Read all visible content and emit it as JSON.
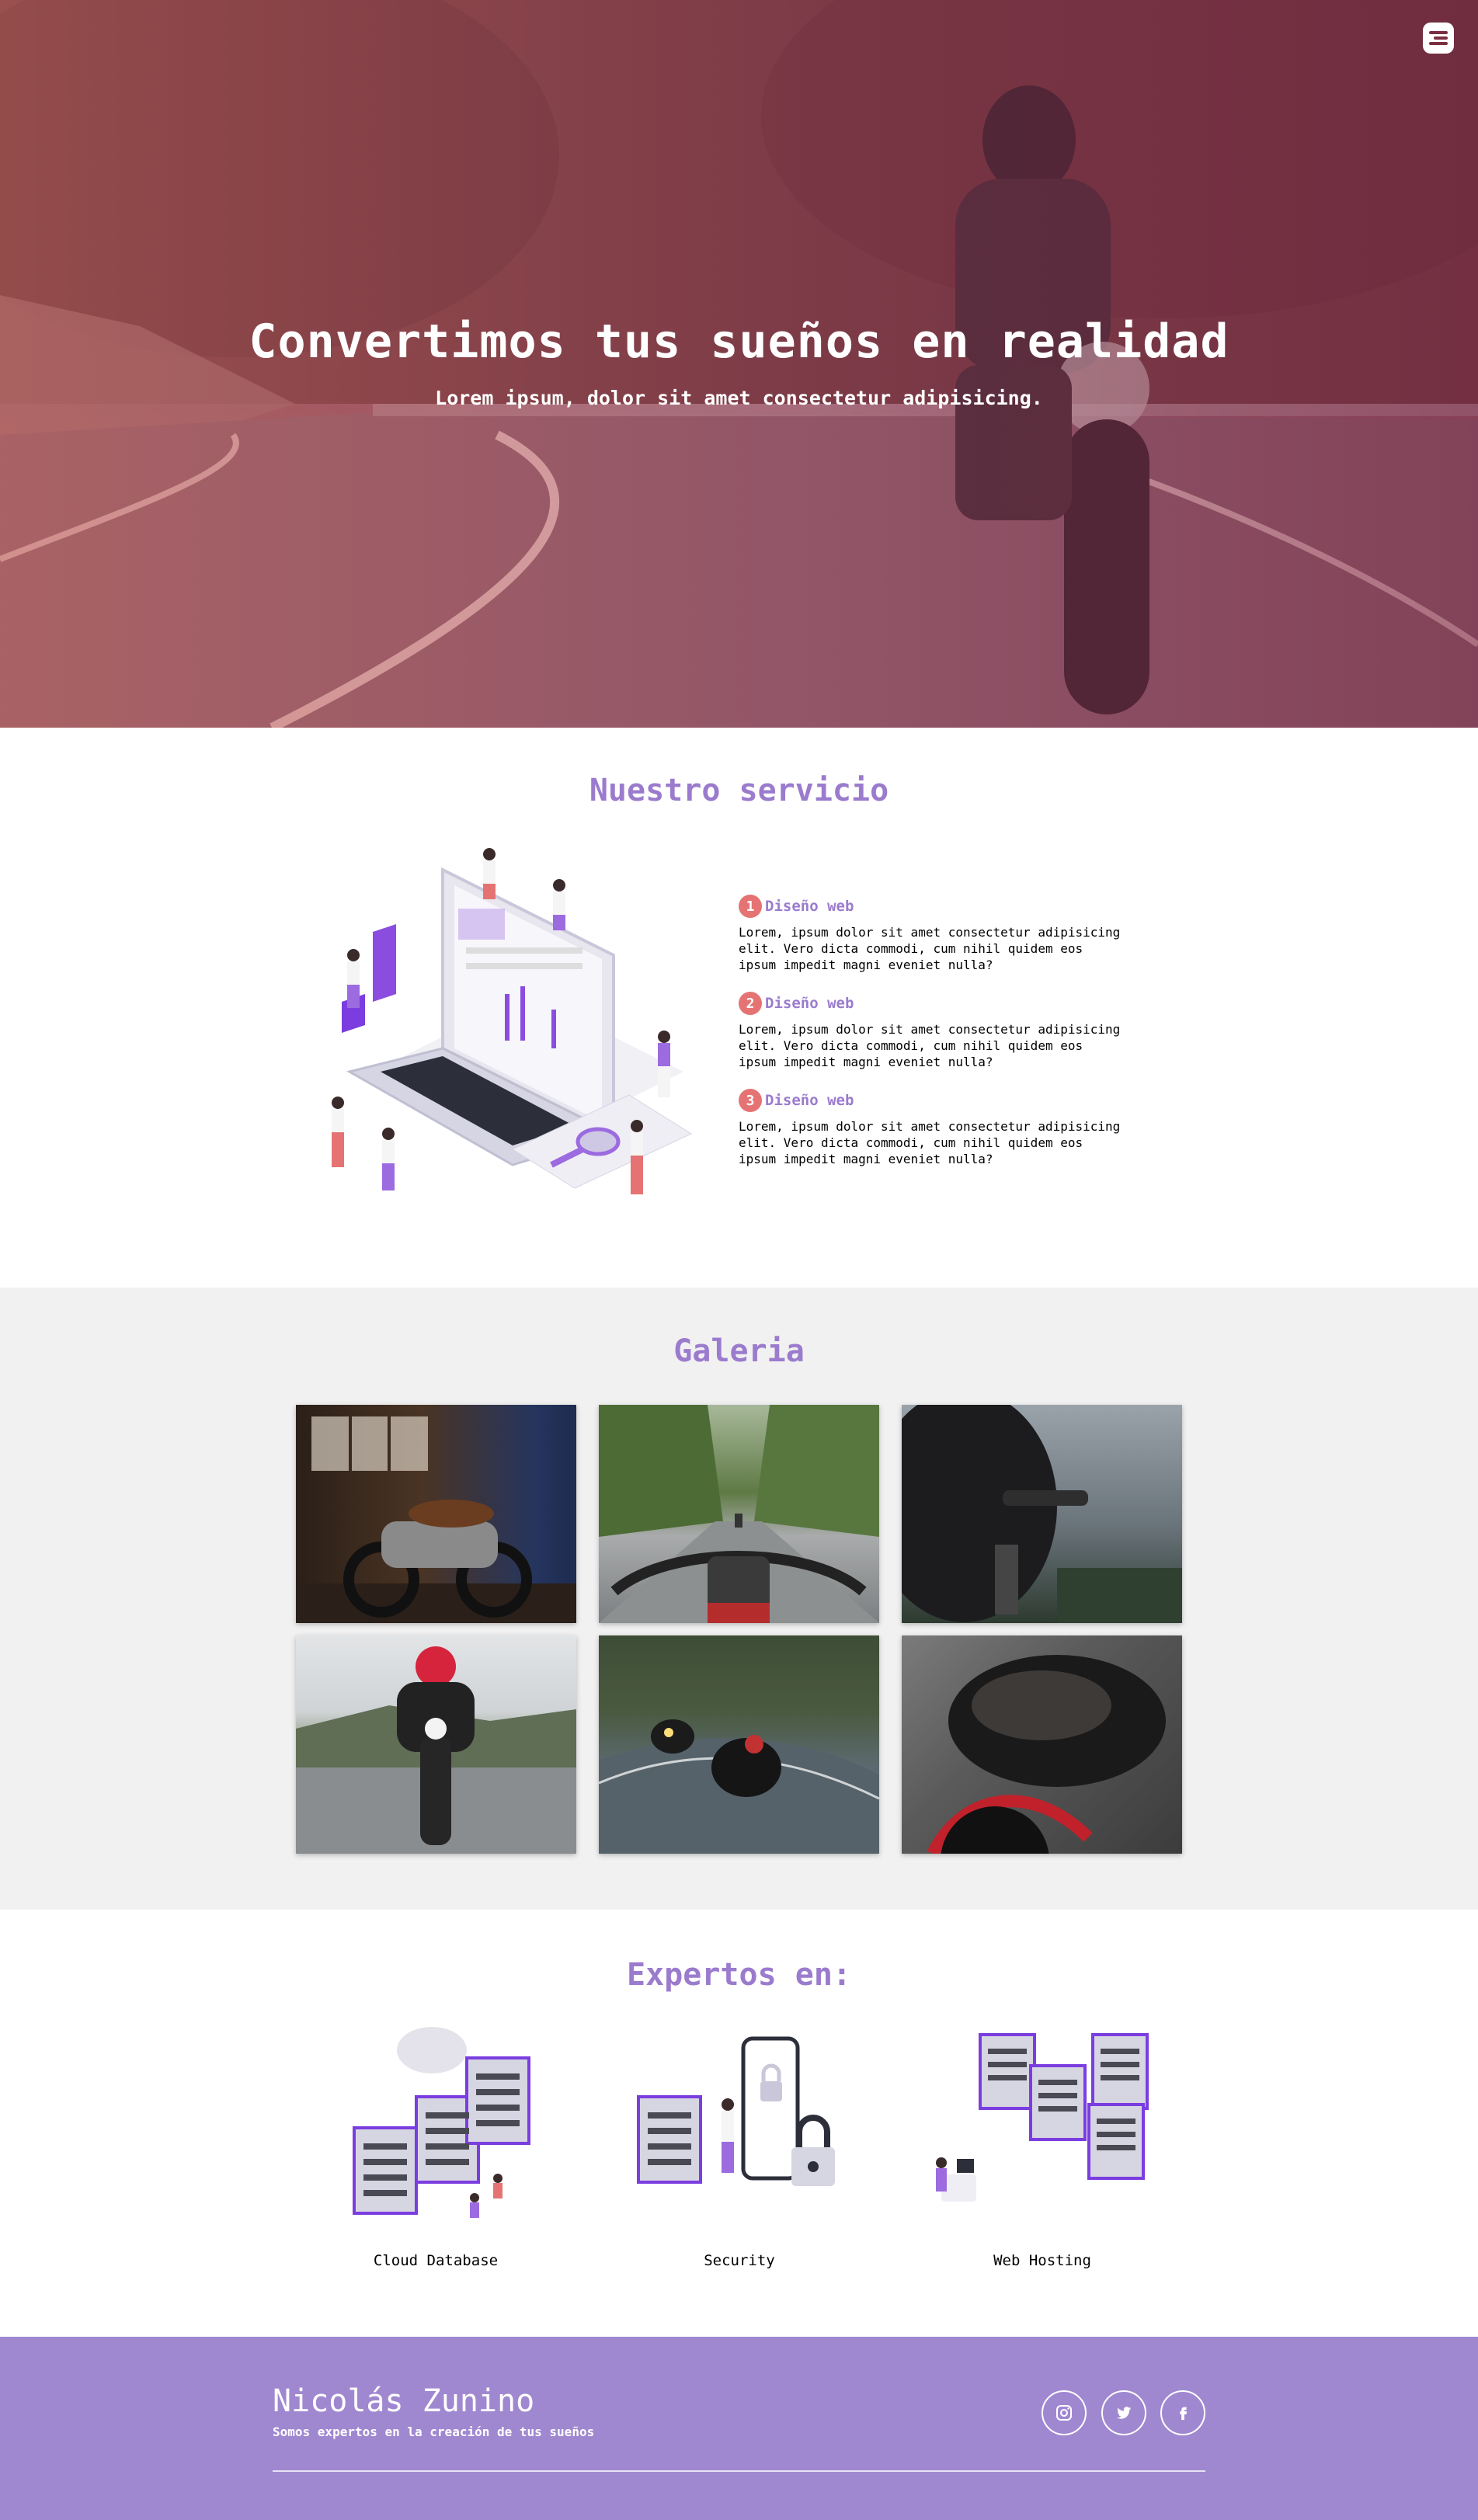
{
  "hero": {
    "title": "Convertimos tus sueños en realidad",
    "subtitle": "Lorem ipsum, dolor sit amet consectetur adipisicing."
  },
  "services": {
    "title": "Nuestro servicio",
    "items": [
      {
        "number": "1",
        "name": "Diseño web",
        "description": "Lorem, ipsum dolor sit amet consectetur adipisicing elit. Vero dicta commodi, cum nihil quidem eos ipsum impedit magni eveniet nulla?"
      },
      {
        "number": "2",
        "name": "Diseño web",
        "description": "Lorem, ipsum dolor sit amet consectetur adipisicing elit. Vero dicta commodi, cum nihil quidem eos ipsum impedit magni eveniet nulla?"
      },
      {
        "number": "3",
        "name": "Diseño web",
        "description": "Lorem, ipsum dolor sit amet consectetur adipisicing elit. Vero dicta commodi, cum nihil quidem eos ipsum impedit magni eveniet nulla?"
      }
    ]
  },
  "gallery": {
    "title": "Galeria"
  },
  "experts": {
    "title": "Expertos en:",
    "items": [
      {
        "label": "Cloud Database"
      },
      {
        "label": "Security"
      },
      {
        "label": "Web Hosting"
      }
    ]
  },
  "footer": {
    "name": "Nicolás Zunino",
    "tagline": "Somos expertos en la creación de tus sueños",
    "social": [
      "instagram-icon",
      "twitter-icon",
      "facebook-icon"
    ]
  },
  "colors": {
    "accent": "#9b7bcd",
    "footer_bg": "#a088d1",
    "number_badge": "#e57373",
    "gallery_bg": "#f1f1f1"
  }
}
